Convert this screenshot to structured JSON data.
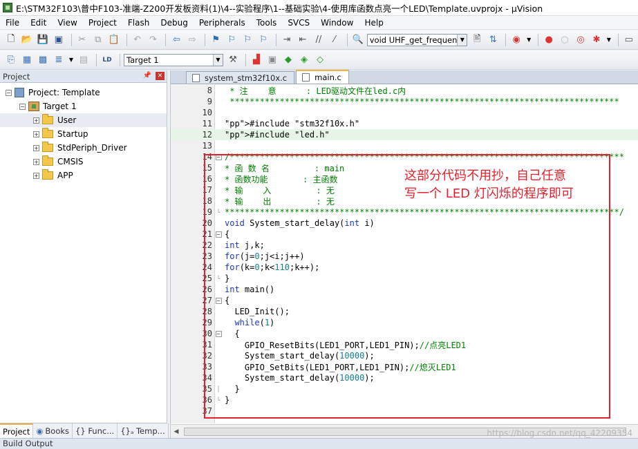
{
  "window": {
    "title": "E:\\STM32F103\\普中F103-准端-Z200开发板资料(1)\\4--实验程序\\1--基础实验\\4-使用库函数点亮一个LED\\Template.uvprojx - µVision"
  },
  "menubar": {
    "items": [
      "File",
      "Edit",
      "View",
      "Project",
      "Flash",
      "Debug",
      "Peripherals",
      "Tools",
      "SVCS",
      "Window",
      "Help"
    ]
  },
  "toolbar1": {
    "function_combo": "void UHF_get_frequency"
  },
  "toolbar2": {
    "target_combo": "Target 1"
  },
  "project_panel": {
    "header": "Project",
    "root": "Project: Template",
    "target": "Target 1",
    "groups": [
      "User",
      "Startup",
      "StdPeriph_Driver",
      "CMSIS",
      "APP"
    ],
    "tabs": [
      "Project",
      "Books",
      "{} Func...",
      "{}ₐ Temp..."
    ]
  },
  "editor": {
    "tabs": [
      "system_stm32f10x.c",
      "main.c"
    ],
    "active_tab": "main.c",
    "lines": [
      {
        "n": "8",
        "t": " * 注    意      : LED驱动文件在led.c内"
      },
      {
        "n": "9",
        "t": " ******************************************************************************"
      },
      {
        "n": "10",
        "t": ""
      },
      {
        "n": "11",
        "t": "#include \"stm32f10x.h\""
      },
      {
        "n": "12",
        "t": "#include \"led.h\""
      },
      {
        "n": "13",
        "t": ""
      },
      {
        "n": "14",
        "t": "/*******************************************************************************"
      },
      {
        "n": "15",
        "t": "* 函 数 名         : main"
      },
      {
        "n": "16",
        "t": "* 函数功能       : 主函数"
      },
      {
        "n": "17",
        "t": "* 输    入         : 无"
      },
      {
        "n": "18",
        "t": "* 输    出         : 无"
      },
      {
        "n": "19",
        "t": "*******************************************************************************/"
      },
      {
        "n": "20",
        "t": "void System_start_delay(int i)"
      },
      {
        "n": "21",
        "t": "{"
      },
      {
        "n": "22",
        "t": "int j,k;"
      },
      {
        "n": "23",
        "t": "for(j=0;j<i;j++)"
      },
      {
        "n": "24",
        "t": "for(k=0;k<110;k++);"
      },
      {
        "n": "25",
        "t": "}"
      },
      {
        "n": "26",
        "t": "int main()"
      },
      {
        "n": "27",
        "t": "{"
      },
      {
        "n": "28",
        "t": "  LED_Init();"
      },
      {
        "n": "29",
        "t": "  while(1)"
      },
      {
        "n": "30",
        "t": "  {"
      },
      {
        "n": "31",
        "t": "    GPIO_ResetBits(LED1_PORT,LED1_PIN);//点亮LED1"
      },
      {
        "n": "32",
        "t": "    System_start_delay(10000);"
      },
      {
        "n": "33",
        "t": "    GPIO_SetBits(LED1_PORT,LED1_PIN);//熄灭LED1"
      },
      {
        "n": "34",
        "t": "    System_start_delay(10000);"
      },
      {
        "n": "35",
        "t": "  }"
      },
      {
        "n": "36",
        "t": "}"
      },
      {
        "n": "37",
        "t": ""
      }
    ],
    "annotation_line1": "这部分代码不用抄，自己任意",
    "annotation_line2": "写一个 LED 灯闪烁的程序即可"
  },
  "bottom": {
    "build_output": "Build Output",
    "watermark": "https://blog.csdn.net/qq_42209354"
  },
  "colors": {
    "annotation": "#e4202b",
    "keyword": "#1c36c8",
    "comment": "#008000",
    "string": "#8b1a8b"
  }
}
